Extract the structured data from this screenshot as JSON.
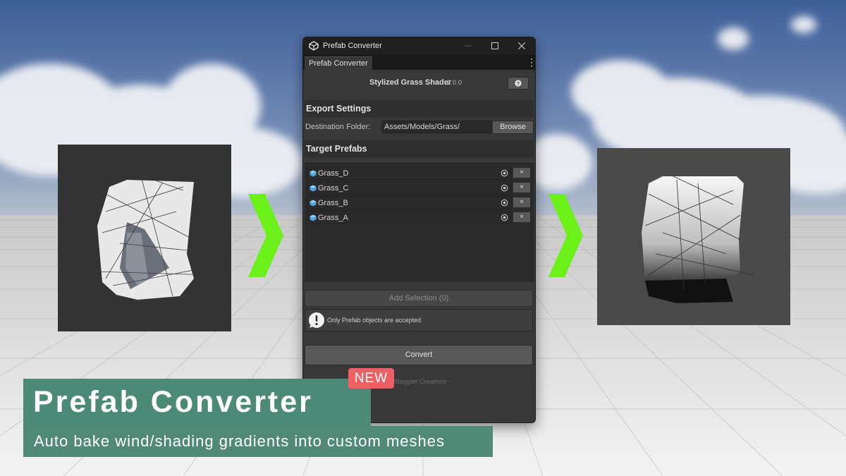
{
  "window": {
    "title": "Prefab Converter",
    "tab_label": "Prefab Converter",
    "tab_menu": "⋮",
    "plugin_name": "Stylized Grass Shader",
    "plugin_version": "2.0.0",
    "help_icon": "question-icon"
  },
  "export_settings": {
    "header": "Export Settings",
    "destination_label": "Destination Folder:",
    "destination_value": "Assets/Models/Grass/",
    "browse_label": "Browse"
  },
  "target_prefabs": {
    "header": "Target Prefabs",
    "items": [
      {
        "name": "Grass_D",
        "remove_label": "×"
      },
      {
        "name": "Grass_C",
        "remove_label": "×"
      },
      {
        "name": "Grass_B",
        "remove_label": "×"
      },
      {
        "name": "Grass_A",
        "remove_label": "×"
      }
    ],
    "add_selection_label": "Add Selection (0)",
    "info_message": "Only Prefab objects are accepted",
    "convert_label": "Convert",
    "footer_credit": "- Staggart Creations -"
  },
  "banner": {
    "title": "Prefab Converter",
    "badge": "NEW",
    "subtitle": "Auto bake wind/shading gradients into custom meshes"
  },
  "colors": {
    "accent_arrow": "#6cf01a",
    "banner_green": "#4c8a77",
    "badge_red": "#ef5f64"
  }
}
